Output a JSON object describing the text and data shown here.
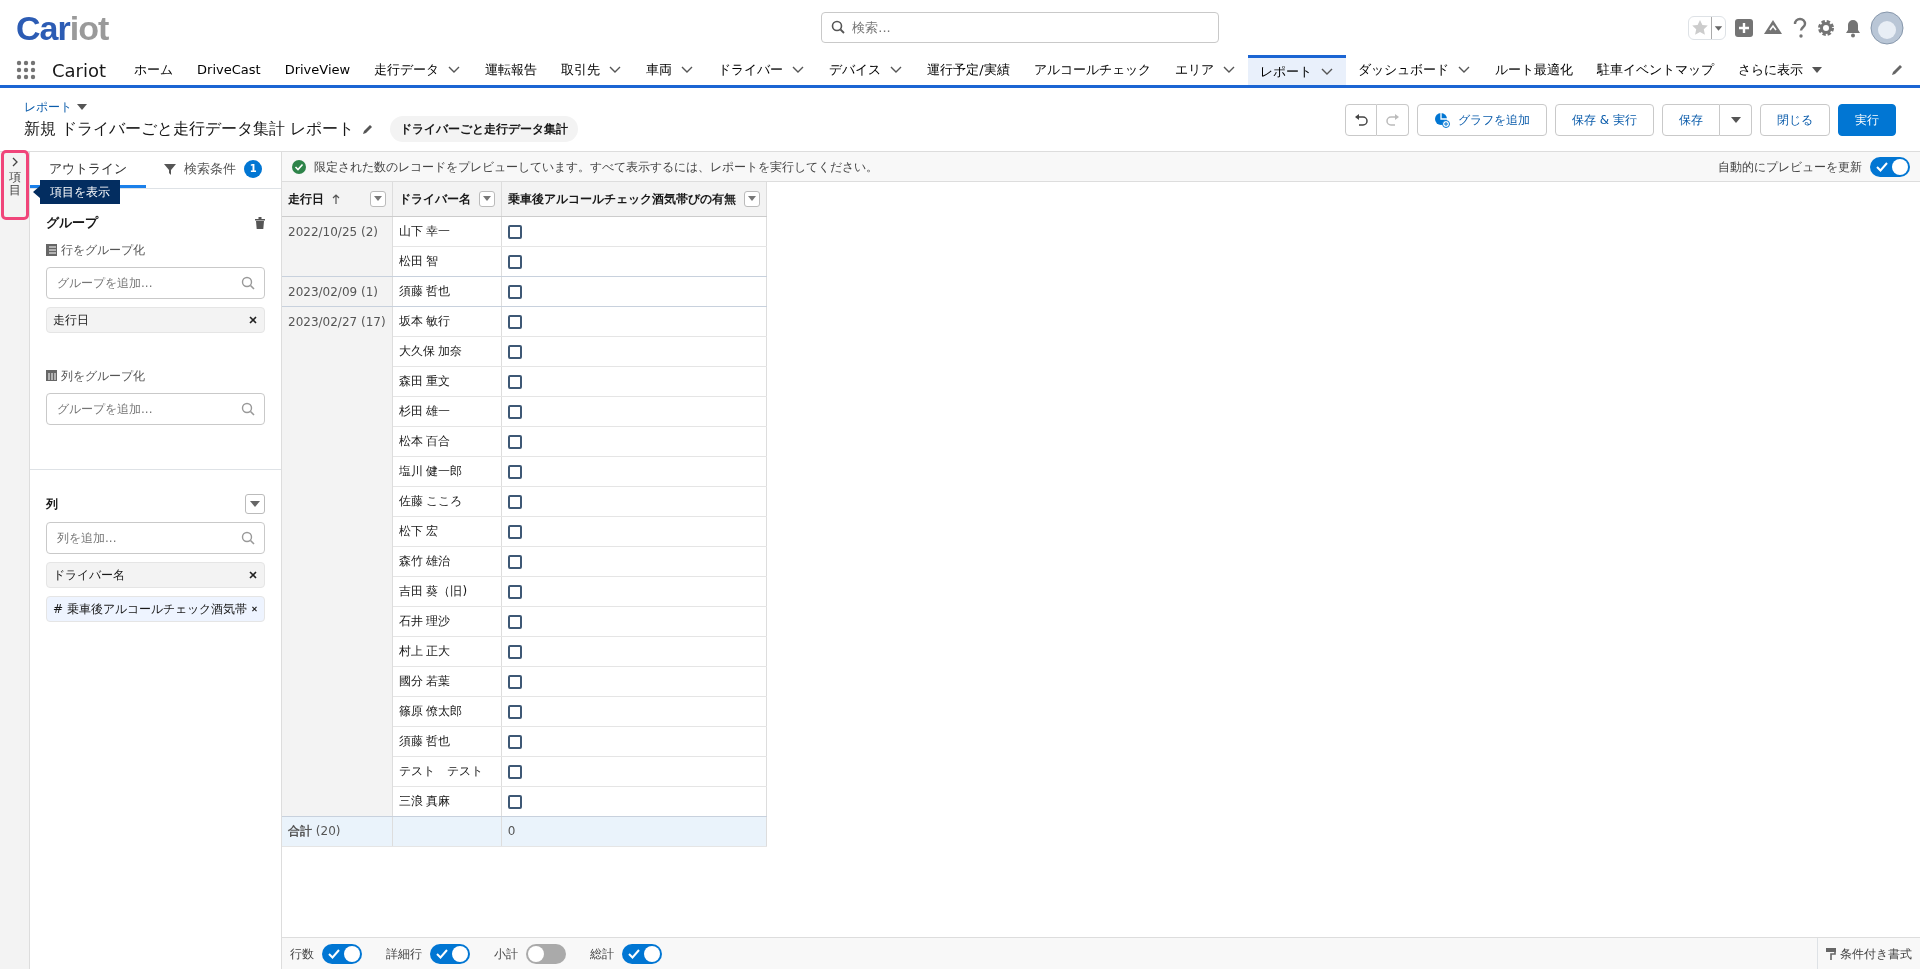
{
  "header": {
    "logo": {
      "parts": [
        "Car",
        "iot"
      ]
    },
    "search": {
      "placeholder": "検索..."
    }
  },
  "nav": {
    "app_name": "Cariot",
    "items": [
      {
        "label": "ホーム",
        "dropdown": false,
        "selected": false
      },
      {
        "label": "DriveCast",
        "dropdown": false,
        "selected": false
      },
      {
        "label": "DriveView",
        "dropdown": false,
        "selected": false
      },
      {
        "label": "走行データ",
        "dropdown": true,
        "selected": false
      },
      {
        "label": "運転報告",
        "dropdown": false,
        "selected": false
      },
      {
        "label": "取引先",
        "dropdown": true,
        "selected": false
      },
      {
        "label": "車両",
        "dropdown": true,
        "selected": false
      },
      {
        "label": "ドライバー",
        "dropdown": true,
        "selected": false
      },
      {
        "label": "デバイス",
        "dropdown": true,
        "selected": false
      },
      {
        "label": "運行予定/実績",
        "dropdown": false,
        "selected": false
      },
      {
        "label": "アルコールチェック",
        "dropdown": false,
        "selected": false
      },
      {
        "label": "エリア",
        "dropdown": true,
        "selected": false
      },
      {
        "label": "レポート",
        "dropdown": true,
        "selected": true
      },
      {
        "label": "ダッシュボード",
        "dropdown": true,
        "selected": false
      },
      {
        "label": "ルート最適化",
        "dropdown": false,
        "selected": false
      },
      {
        "label": "駐車イベントマップ",
        "dropdown": false,
        "selected": false
      }
    ],
    "more": "さらに表示"
  },
  "page_header": {
    "breadcrumb": "レポート",
    "title": "新規 ドライバーごと走行データ集計 レポート",
    "report_type": "ドライバーごと走行データ集計",
    "buttons": [
      {
        "kind": "graph",
        "label": "グラフを追加"
      },
      {
        "kind": "plain",
        "label": "保存 & 実行"
      },
      {
        "kind": "split",
        "label": "保存"
      },
      {
        "kind": "plain",
        "label": "閉じる"
      },
      {
        "kind": "primary",
        "label": "実行"
      }
    ],
    "undo_disabled": false,
    "redo_disabled": true
  },
  "rail": {
    "label": "項目",
    "tooltip": "項目を表示"
  },
  "panel": {
    "tabs": [
      {
        "label": "アウトライン",
        "selected": true
      },
      {
        "label": "検索条件",
        "selected": false,
        "count": "1"
      }
    ],
    "group_title": "グループ",
    "row_group": {
      "label": "行をグループ化",
      "placeholder": "グループを追加...",
      "chips": [
        {
          "label": "走行日",
          "highlighted": false
        }
      ]
    },
    "col_group": {
      "label": "列をグループ化",
      "placeholder": "グループを追加..."
    },
    "columns": {
      "title": "列",
      "placeholder": "列を追加...",
      "chips": [
        {
          "label": "ドライバー名",
          "highlighted": false
        },
        {
          "label": "乗車後アルコールチェック酒気帯",
          "prefix": "#",
          "highlighted": true
        }
      ]
    }
  },
  "preview": {
    "message": "限定された数のレコードをプレビューしています。すべて表示するには、レポートを実行してください。",
    "auto_update": {
      "label": "自動的にプレビューを更新",
      "on": true
    }
  },
  "table": {
    "columns": [
      {
        "label": "走行日",
        "sorted": true
      },
      {
        "label": "ドライバー名",
        "sorted": false
      },
      {
        "label": "乗車後アルコールチェック酒気帯びの有無",
        "sorted": false
      }
    ],
    "groups": [
      {
        "date": "2022/10/25 (2)",
        "rows": [
          {
            "driver": "山下 幸一",
            "checked": false
          },
          {
            "driver": "松田 智",
            "checked": false
          }
        ]
      },
      {
        "date": "2023/02/09 (1)",
        "rows": [
          {
            "driver": "須藤 哲也",
            "checked": false
          }
        ]
      },
      {
        "date": "2023/02/27 (17)",
        "rows": [
          {
            "driver": "坂本 敏行",
            "checked": false
          },
          {
            "driver": "大久保 加奈",
            "checked": false
          },
          {
            "driver": "森田 重文",
            "checked": false
          },
          {
            "driver": "杉田 雄一",
            "checked": false
          },
          {
            "driver": "松本 百合",
            "checked": false
          },
          {
            "driver": "塩川 健一郎",
            "checked": false
          },
          {
            "driver": "佐藤 こころ",
            "checked": false
          },
          {
            "driver": "松下 宏",
            "checked": false
          },
          {
            "driver": "森竹 雄治",
            "checked": false
          },
          {
            "driver": "吉田 葵（旧)",
            "checked": false
          },
          {
            "driver": "石井 理沙",
            "checked": false
          },
          {
            "driver": "村上 正大",
            "checked": false
          },
          {
            "driver": "國分 若葉",
            "checked": false
          },
          {
            "driver": "篠原 僚太郎",
            "checked": false
          },
          {
            "driver": "須藤 哲也",
            "checked": false
          },
          {
            "driver": "テスト　テスト",
            "checked": false
          },
          {
            "driver": "三浪 真麻",
            "checked": false
          }
        ]
      }
    ],
    "total": {
      "label": "**合計** (20)",
      "value": "0"
    }
  },
  "footer": {
    "toggles": [
      {
        "label": "行数",
        "on": true
      },
      {
        "label": "詳細行",
        "on": true
      },
      {
        "label": "小計",
        "on": false
      },
      {
        "label": "総計",
        "on": true
      }
    ],
    "conditional_format": "条件付き書式"
  }
}
